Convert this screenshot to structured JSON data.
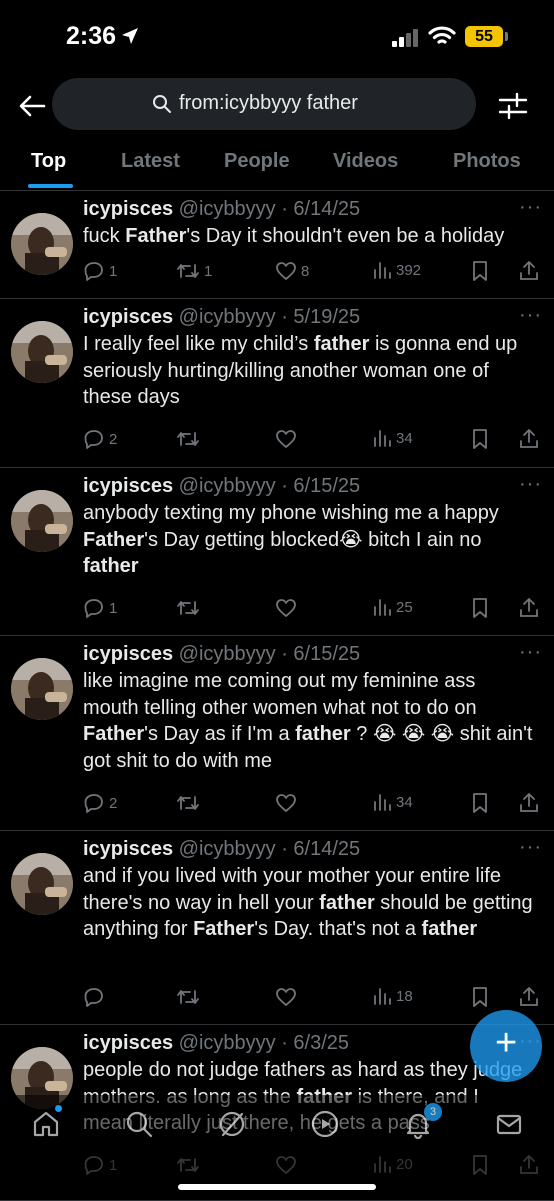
{
  "status_bar": {
    "time": "2:36",
    "battery": "55"
  },
  "search": {
    "query": "from:icybbyyy father"
  },
  "tabs": [
    "Top",
    "Latest",
    "People",
    "Videos",
    "Photos"
  ],
  "colors": {
    "accent": "#1d9bf0",
    "background": "#000000",
    "muted": "#71767b",
    "battery": "#f5c400"
  },
  "tweets": [
    {
      "name": "icypisces",
      "handle": "@icybbyyy",
      "date": "· 6/14/25",
      "text": [
        {
          "t": "fuck "
        },
        {
          "t": "Father",
          "b": true
        },
        {
          "t": "'s Day it shouldn't even be a holiday"
        }
      ],
      "replies": "1",
      "retweets": "1",
      "likes": "8",
      "views": "392"
    },
    {
      "name": "icypisces",
      "handle": "@icybbyyy",
      "date": "· 5/19/25",
      "text": [
        {
          "t": "I really feel like my child’s "
        },
        {
          "t": "father",
          "b": true
        },
        {
          "t": " is gonna end up seriously hurting/killing another woman one of these days"
        }
      ],
      "replies": "2",
      "retweets": "",
      "likes": "",
      "views": "34"
    },
    {
      "name": "icypisces",
      "handle": "@icybbyyy",
      "date": "· 6/15/25",
      "text": [
        {
          "t": "anybody texting my phone wishing me a happy "
        },
        {
          "t": "Father",
          "b": true
        },
        {
          "t": "'s Day getting blocked😭 bitch I ain no "
        },
        {
          "t": "father",
          "b": true
        }
      ],
      "replies": "1",
      "retweets": "",
      "likes": "",
      "views": "25"
    },
    {
      "name": "icypisces",
      "handle": "@icybbyyy",
      "date": "· 6/15/25",
      "text": [
        {
          "t": "like imagine me coming out my feminine ass mouth telling other women what not to do on "
        },
        {
          "t": "Father",
          "b": true
        },
        {
          "t": "'s Day as if I'm a "
        },
        {
          "t": "father",
          "b": true
        },
        {
          "t": " ? 😭 😭 😭 shit ain't got shit to do with me"
        }
      ],
      "replies": "2",
      "retweets": "",
      "likes": "",
      "views": "34"
    },
    {
      "name": "icypisces",
      "handle": "@icybbyyy",
      "date": "· 6/14/25",
      "text": [
        {
          "t": "and if you lived with your mother your entire life there's no way in hell your "
        },
        {
          "t": "father",
          "b": true
        },
        {
          "t": " should be getting anything for "
        },
        {
          "t": "Father",
          "b": true
        },
        {
          "t": "'s Day. that's not a "
        },
        {
          "t": "father",
          "b": true
        }
      ],
      "replies": "",
      "retweets": "",
      "likes": "",
      "views": "18"
    },
    {
      "name": "icypisces",
      "handle": "@icybbyyy",
      "date": "· 6/3/25",
      "text": [
        {
          "t": "people do not judge fathers as hard as they judge mothers. as long as the "
        },
        {
          "t": "father",
          "b": true
        },
        {
          "t": " is there, and I mean literally just there, he gets a pass"
        }
      ],
      "replies": "1",
      "retweets": "",
      "likes": "",
      "views": "20"
    }
  ],
  "notifications_badge": "3"
}
